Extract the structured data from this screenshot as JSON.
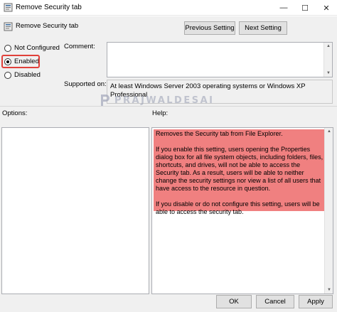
{
  "window": {
    "title": "Remove Security tab",
    "minimize_glyph": "—",
    "maximize_glyph": "☐",
    "close_glyph": "✕"
  },
  "header": {
    "title": "Remove Security tab",
    "previous_label": "Previous Setting",
    "next_label": "Next Setting"
  },
  "state": {
    "options": [
      {
        "label": "Not Configured",
        "selected": false
      },
      {
        "label": "Enabled",
        "selected": true
      },
      {
        "label": "Disabled",
        "selected": false
      }
    ]
  },
  "comment": {
    "label": "Comment:",
    "value": ""
  },
  "supported": {
    "label": "Supported on:",
    "value": "At least Windows Server 2003 operating systems or Windows XP Professional"
  },
  "panels": {
    "options_label": "Options:",
    "help_label": "Help:"
  },
  "help": {
    "paragraphs": [
      "Removes the Security tab from File Explorer.",
      "If you enable this setting, users opening the Properties dialog box for all file system objects, including folders, files, shortcuts, and drives, will not be able to access the Security tab. As a result, users will be able to neither change the security settings nor view a list of all users that have access to the resource in question.",
      "If you disable or do not configure this setting, users will be able to access the security tab."
    ],
    "highlight_color": "#f08080"
  },
  "watermark": {
    "text": "PRAJWALDESAI"
  },
  "footer": {
    "ok_label": "OK",
    "cancel_label": "Cancel",
    "apply_label": "Apply"
  },
  "colors": {
    "highlight_border": "#e0403a",
    "help_highlight": "#f08080",
    "button_face": "#e1e1e1"
  },
  "icons": {
    "window": "policy-icon",
    "header": "policy-setting-icon",
    "watermark": "prajwaldesai-logo"
  }
}
